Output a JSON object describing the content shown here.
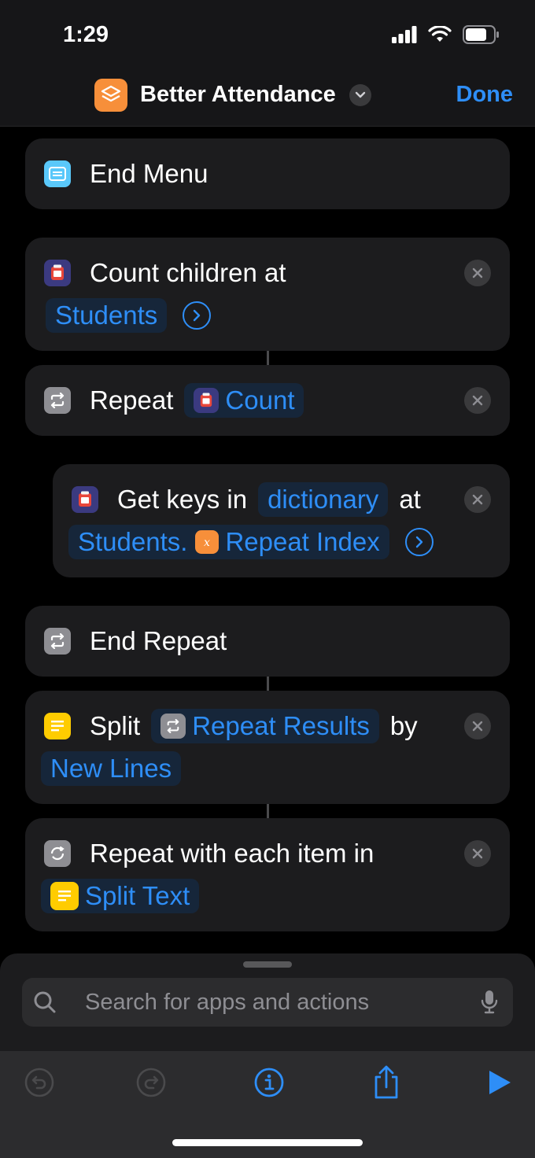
{
  "status": {
    "time": "1:29"
  },
  "nav": {
    "title": "Better Attendance",
    "done_label": "Done"
  },
  "actions": {
    "end_menu": {
      "label": "End Menu"
    },
    "count": {
      "label": "Count children at",
      "token": "Students"
    },
    "repeat": {
      "label": "Repeat",
      "token": "Count"
    },
    "get_keys": {
      "label": "Get keys in",
      "token_dict": "dictionary",
      "at_label": "at",
      "token_path_prefix": "Students.",
      "token_path_var": "Repeat Index"
    },
    "end_repeat": {
      "label": "End Repeat"
    },
    "split": {
      "label": "Split",
      "token": "Repeat Results",
      "by_label": "by",
      "token_sep": "New Lines"
    },
    "repeat_each": {
      "label": "Repeat with each item in",
      "token": "Split Text"
    }
  },
  "search": {
    "placeholder": "Search for apps and actions"
  },
  "colors": {
    "accent": "#2e8ef7",
    "card": "#1c1c1e",
    "orange": "#f78f3a",
    "yellow": "#ffcc00"
  },
  "icons": [
    "wifi-icon",
    "battery-icon",
    "signal-icon",
    "shortcuts-app-icon",
    "menu-icon",
    "dictionary-icon",
    "repeat-icon",
    "text-icon",
    "variable-icon",
    "search-icon",
    "mic-icon",
    "undo-icon",
    "redo-icon",
    "info-icon",
    "share-icon",
    "play-icon"
  ]
}
